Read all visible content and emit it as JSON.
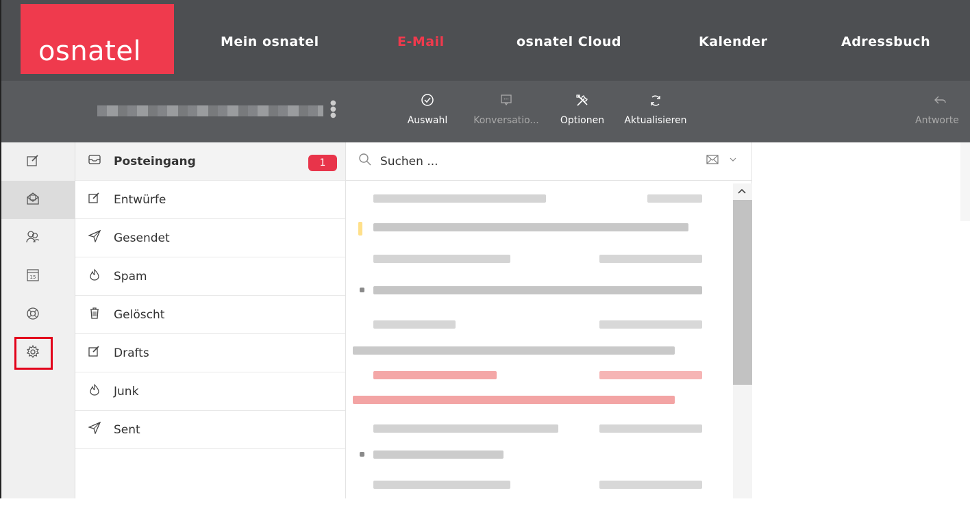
{
  "brand": {
    "logo_text": "osnatel",
    "accent": "#ef3a4d",
    "header_bg": "#4d4f52"
  },
  "nav": {
    "items": [
      {
        "label": "Mein osnatel",
        "active": false
      },
      {
        "label": "E-Mail",
        "active": true
      },
      {
        "label": "osnatel Cloud",
        "active": false
      },
      {
        "label": "Kalender",
        "active": false
      },
      {
        "label": "Adressbuch",
        "active": false
      }
    ]
  },
  "toolbar": {
    "buttons": [
      {
        "label": "Auswahl",
        "icon": "check-circle-icon",
        "enabled": true
      },
      {
        "label": "Konversatio...",
        "icon": "chat-bubble-icon",
        "enabled": false
      },
      {
        "label": "Optionen",
        "icon": "tools-icon",
        "enabled": true
      },
      {
        "label": "Aktualisieren",
        "icon": "refresh-icon",
        "enabled": true
      },
      {
        "label": "Antworte",
        "icon": "reply-icon",
        "enabled": false
      }
    ]
  },
  "rail": {
    "items": [
      {
        "icon": "compose-icon",
        "active": false
      },
      {
        "icon": "mail-icon",
        "active": true
      },
      {
        "icon": "contacts-icon",
        "active": false
      },
      {
        "icon": "calendar-icon",
        "active": false,
        "calendar_day": "15"
      },
      {
        "icon": "help-icon",
        "active": false
      },
      {
        "icon": "settings-icon",
        "active": false,
        "highlighted": true
      }
    ]
  },
  "folders": [
    {
      "label": "Posteingang",
      "icon": "inbox-icon",
      "active": true,
      "badge": "1"
    },
    {
      "label": "Entwürfe",
      "icon": "drafts-icon"
    },
    {
      "label": "Gesendet",
      "icon": "send-icon"
    },
    {
      "label": "Spam",
      "icon": "spam-icon"
    },
    {
      "label": "Gelöscht",
      "icon": "trash-icon"
    },
    {
      "label": "Drafts",
      "icon": "drafts-icon"
    },
    {
      "label": "Junk",
      "icon": "spam-icon"
    },
    {
      "label": "Sent",
      "icon": "send-icon"
    }
  ],
  "search": {
    "placeholder": "Suchen ..."
  },
  "message_list": {
    "rows_count_visible": 9,
    "unread_color": "#f08080"
  }
}
